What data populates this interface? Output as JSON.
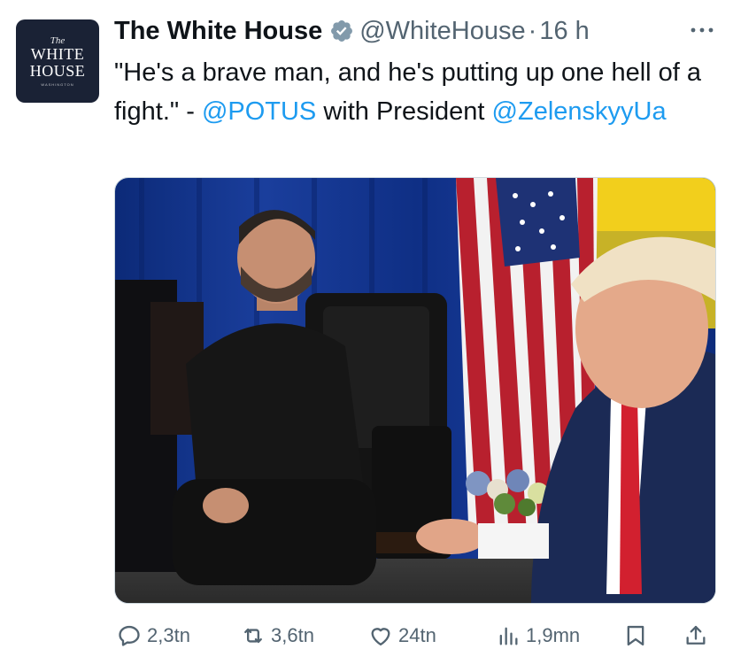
{
  "avatar": {
    "line_the": "The",
    "line_1": "WHITE",
    "line_2": "HOUSE",
    "line_small": "WASHINGTON"
  },
  "tweet": {
    "author_name": "The White House",
    "handle": "@WhiteHouse",
    "separator": "·",
    "time": "16 h",
    "text_part1": "\"He's a brave man, and he's putting up one hell of a fight.\" - ",
    "mention_1": "@POTUS",
    "text_part2": " with President ",
    "mention_2": "@ZelenskyyUa"
  },
  "actions": {
    "replies": "2,3tn",
    "reposts": "3,6tn",
    "likes": "24tn",
    "views": "1,9mn"
  },
  "colors": {
    "accent": "#1d9bf0",
    "secondary_text": "#536471",
    "primary_text": "#0f1419",
    "avatar_bg": "#1a2235"
  },
  "icons": {
    "verified": "verified-badge-icon",
    "more": "more-icon",
    "reply": "reply-icon",
    "repost": "repost-icon",
    "like": "like-icon",
    "views": "views-icon",
    "bookmark": "bookmark-icon",
    "share": "share-icon"
  }
}
